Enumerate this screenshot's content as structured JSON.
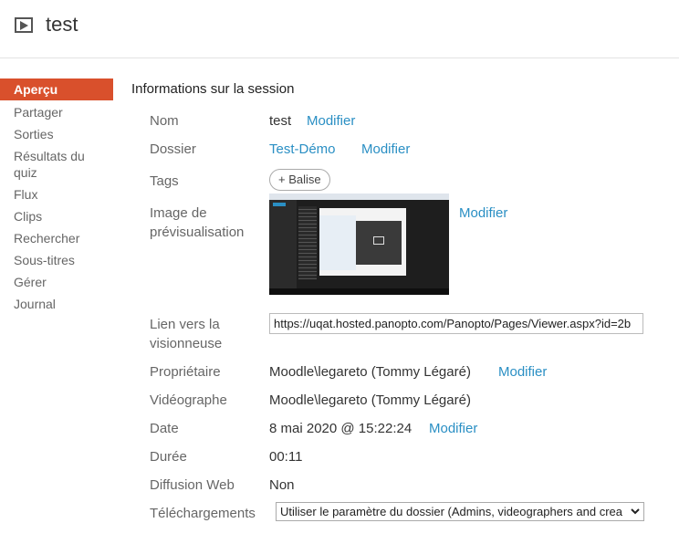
{
  "header": {
    "title": "test",
    "icon": "play-icon"
  },
  "sidebar": {
    "items": [
      {
        "label": "Aperçu"
      },
      {
        "label": "Partager"
      },
      {
        "label": "Sorties"
      },
      {
        "label": "Résultats du quiz"
      },
      {
        "label": "Flux"
      },
      {
        "label": "Clips"
      },
      {
        "label": "Rechercher"
      },
      {
        "label": "Sous-titres"
      },
      {
        "label": "Gérer"
      },
      {
        "label": "Journal"
      }
    ]
  },
  "main": {
    "section_title": "Informations sur la session",
    "fields": {
      "nom": {
        "label": "Nom",
        "value": "test",
        "action": "Modifier"
      },
      "dossier": {
        "label": "Dossier",
        "value": "Test-Démo",
        "action": "Modifier"
      },
      "tags": {
        "label": "Tags",
        "button": "+ Balise"
      },
      "image": {
        "label": "Image de prévisualisation",
        "action": "Modifier"
      },
      "lien": {
        "label": "Lien vers la visionneuse",
        "value": "https://uqat.hosted.panopto.com/Panopto/Pages/Viewer.aspx?id=2b"
      },
      "proprietaire": {
        "label": "Propriétaire",
        "value": "Moodle\\legareto (Tommy Légaré)",
        "action": "Modifier"
      },
      "videographe": {
        "label": "Vidéographe",
        "value": "Moodle\\legareto (Tommy Légaré)"
      },
      "date": {
        "label": "Date",
        "value": "8 mai 2020 @ 15:22:24",
        "action": "Modifier"
      },
      "duree": {
        "label": "Durée",
        "value": "00:11"
      },
      "diffusion": {
        "label": "Diffusion Web",
        "value": "Non"
      },
      "telechargements": {
        "label": "Téléchargements",
        "value": "Utiliser le paramètre du dossier (Admins, videographers and crea"
      }
    }
  },
  "colors": {
    "accent": "#d9502c",
    "link": "#2a8fc4"
  }
}
